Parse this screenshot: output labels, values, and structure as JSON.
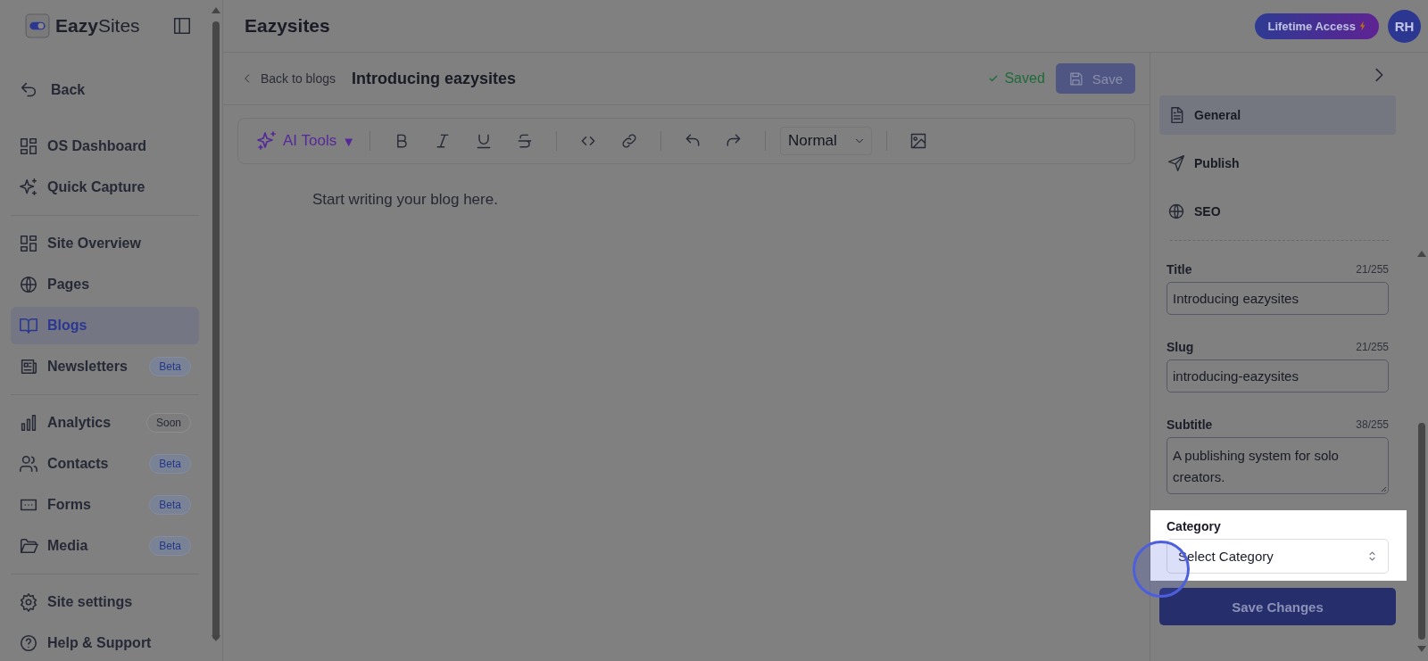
{
  "brand": "**Eazy**Sites",
  "sidebar": {
    "back": "Back",
    "groups": [
      [
        {
          "label": "OS Dashboard",
          "selected": false
        },
        {
          "label": "Quick Capture",
          "selected": false
        }
      ],
      [
        {
          "label": "Site Overview",
          "selected": false
        },
        {
          "label": "Pages",
          "selected": false
        },
        {
          "label": "Blogs",
          "selected": true
        },
        {
          "label": "Newsletters",
          "selected": false,
          "badge": {
            "text": "Beta",
            "kind": "accent"
          }
        }
      ],
      [
        {
          "label": "Analytics",
          "selected": false,
          "badge": {
            "text": "Soon",
            "kind": "muted"
          }
        },
        {
          "label": "Contacts",
          "selected": false,
          "badge": {
            "text": "Beta",
            "kind": "accent"
          }
        },
        {
          "label": "Forms",
          "selected": false,
          "badge": {
            "text": "Beta",
            "kind": "accent"
          }
        },
        {
          "label": "Media",
          "selected": false,
          "badge": {
            "text": "Beta",
            "kind": "accent"
          }
        }
      ],
      [
        {
          "label": "Site settings",
          "selected": false
        },
        {
          "label": "Help & Support",
          "selected": false
        }
      ]
    ]
  },
  "header": {
    "title": "Eazysites",
    "plan": "Lifetime Access",
    "avatar": "RH"
  },
  "editor": {
    "back": "Back to blogs",
    "title": "Introducing eazysites",
    "status": "Saved",
    "save": "Save",
    "ai_tools": "AI Tools",
    "ai_caret": "▼",
    "block_style": "Normal",
    "placeholder": "Start writing your blog here."
  },
  "panel": {
    "tabs": [
      {
        "label": "General",
        "selected": true
      },
      {
        "label": "Publish",
        "selected": false
      },
      {
        "label": "SEO",
        "selected": false
      }
    ],
    "fields": [
      {
        "kind": "input",
        "label": "Title",
        "count": "21/255",
        "value": "Introducing eazysites",
        "highlighted": false
      },
      {
        "kind": "input",
        "label": "Slug",
        "count": "21/255",
        "value": "introducing-eazysites",
        "highlighted": false
      },
      {
        "kind": "textarea",
        "label": "Subtitle",
        "count": "38/255",
        "value": "A publishing system for solo creators.",
        "highlighted": false
      },
      {
        "kind": "select",
        "label": "Category",
        "placeholder": "Select Category",
        "highlighted": true
      }
    ],
    "submit": "Save Changes"
  }
}
